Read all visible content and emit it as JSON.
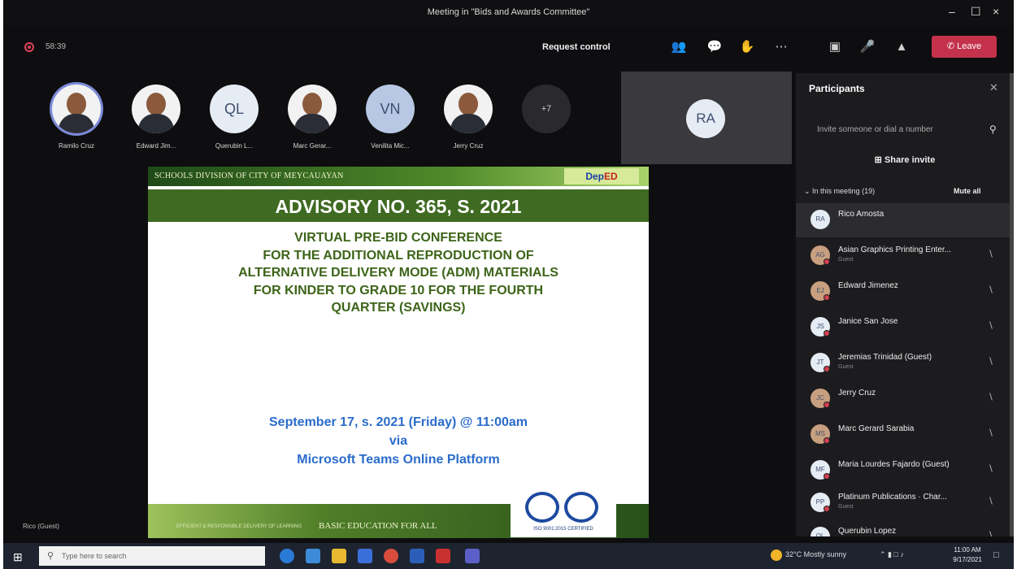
{
  "window": {
    "title": "Meeting in \"Bids and Awards Committee\"",
    "minimize_icon": "–",
    "maximize_icon": "☐",
    "close_icon": "×"
  },
  "toolbar": {
    "timer": "58:39",
    "request_control": "Request control",
    "leave_label": "Leave",
    "accent": "#c4314b"
  },
  "strip": {
    "participants": [
      {
        "name": "Ramilo Cruz",
        "type": "photo"
      },
      {
        "name": "Edward Jim...",
        "type": "photo"
      },
      {
        "name": "Querubin L...",
        "type": "initials",
        "initials": "QL"
      },
      {
        "name": "Marc Gerar...",
        "type": "photo"
      },
      {
        "name": "Venilita Mic...",
        "type": "initials",
        "initials": "VN"
      },
      {
        "name": "Jerry Cruz",
        "type": "photo"
      }
    ],
    "more": "+7",
    "tile_initials": "RA"
  },
  "slide": {
    "division": "SCHOOLS DIVISION OF CITY OF MEYCAUAYAN",
    "logo_dep": "Dep",
    "logo_ed": "ED",
    "advisory": "ADVISORY NO. 365, S. 2021",
    "heading_lines": [
      "VIRTUAL PRE-BID CONFERENCE",
      "FOR THE ADDITIONAL REPRODUCTION OF",
      "ALTERNATIVE DELIVERY MODE (ADM) MATERIALS",
      "FOR KINDER TO GRADE 10 FOR THE FOURTH",
      "QUARTER (SAVINGS)"
    ],
    "date_lines": [
      "September 17, s. 2021 (Friday) @ 11:00am",
      "via",
      "Microsoft Teams Online Platform"
    ],
    "footer_small": "EFFICIENT & RESPONSIBLE DELIVERY OF LEARNING",
    "footer": "BASIC EDUCATION FOR ALL",
    "cert": "ISO 9001:2015 CERTIFIED"
  },
  "panel": {
    "title": "Participants",
    "invite_placeholder": "Invite someone or dial a number",
    "share_invite": "Share invite",
    "in_meeting": "In this meeting (19)",
    "mute_all": "Mute all",
    "people": [
      {
        "name": "Rico Amosta",
        "initials": "RA",
        "sub": ""
      },
      {
        "name": "Asian Graphics Printing Enter...",
        "initials": "AG",
        "sub": "Guest"
      },
      {
        "name": "Edward Jimenez",
        "initials": "EJ",
        "sub": ""
      },
      {
        "name": "Janice San Jose",
        "initials": "JS",
        "sub": ""
      },
      {
        "name": "Jeremias Trinidad (Guest)",
        "initials": "JT",
        "sub": "Guest"
      },
      {
        "name": "Jerry Cruz",
        "initials": "JC",
        "sub": ""
      },
      {
        "name": "Marc Gerard Sarabia",
        "initials": "MS",
        "sub": ""
      },
      {
        "name": "Maria Lourdes Fajardo (Guest)",
        "initials": "MF",
        "sub": ""
      },
      {
        "name": "Platinum Publications · Char...",
        "initials": "PP",
        "sub": "Guest"
      },
      {
        "name": "Querubin Lopez",
        "initials": "QL",
        "sub": ""
      }
    ]
  },
  "bottom_name": "Rico (Guest)",
  "taskbar": {
    "search_placeholder": "Type here to search",
    "weather": "32°C  Mostly sunny",
    "time": "11:00 AM",
    "date": "9/17/2021"
  }
}
